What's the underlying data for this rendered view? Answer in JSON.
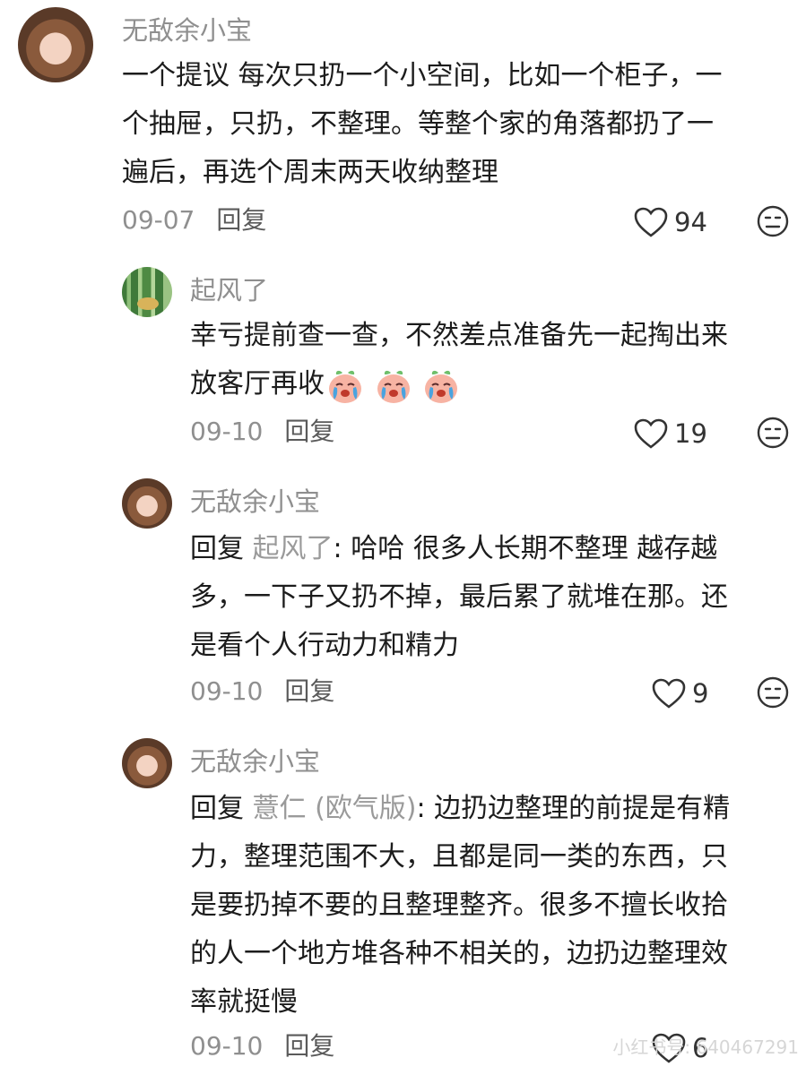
{
  "comments": [
    {
      "username": "无敌余小宝",
      "lines": [
        "一个提议 每次只扔一个小空间，比如一个柜子，一",
        "个抽屉，只扔，不整理。等整个家的角落都扔了一",
        "遍后，再选个周末两天收纳整理"
      ],
      "date": "09-07",
      "reply_label": "回复",
      "likes": "94",
      "avatar_icon": "girl-avatar"
    },
    {
      "username": "起风了",
      "lines": [
        "幸亏提前查一查，不然差点准备先一起掏出来",
        "放客厅再收"
      ],
      "emoji_name": "crying-peach-emoji",
      "date": "09-10",
      "reply_label": "回复",
      "likes": "19",
      "avatar_icon": "bamboo-avatar"
    },
    {
      "username": "无敌余小宝",
      "reply_prefix": "回复 ",
      "reply_to": "起风了",
      "lines_first_rest": ": 哈哈 很多人长期不整理 越存越",
      "lines": [
        "多，一下子又扔不掉，最后累了就堆在那。还",
        "是看个人行动力和精力"
      ],
      "date": "09-10",
      "reply_label": "回复",
      "likes": "9",
      "avatar_icon": "girl-avatar"
    },
    {
      "username": "无敌余小宝",
      "reply_prefix": "回复 ",
      "reply_to": "薏仁 (欧气版)",
      "lines_first_rest": ": 边扔边整理的前提是有精",
      "lines": [
        "力，整理范围不大，且都是同一类的东西，只",
        "是要扔掉不要的且整理整齐。很多不擅长收拾",
        "的人一个地方堆各种不相关的，边扔边整理效",
        "率就挺慢"
      ],
      "date": "09-10",
      "reply_label": "回复",
      "likes": "6",
      "avatar_icon": "girl-avatar"
    }
  ],
  "watermark": "小红书号: 640467291",
  "colors": {
    "text": "#1c1c1c",
    "muted": "#8f8f8f",
    "mention": "#9a9a9a"
  }
}
